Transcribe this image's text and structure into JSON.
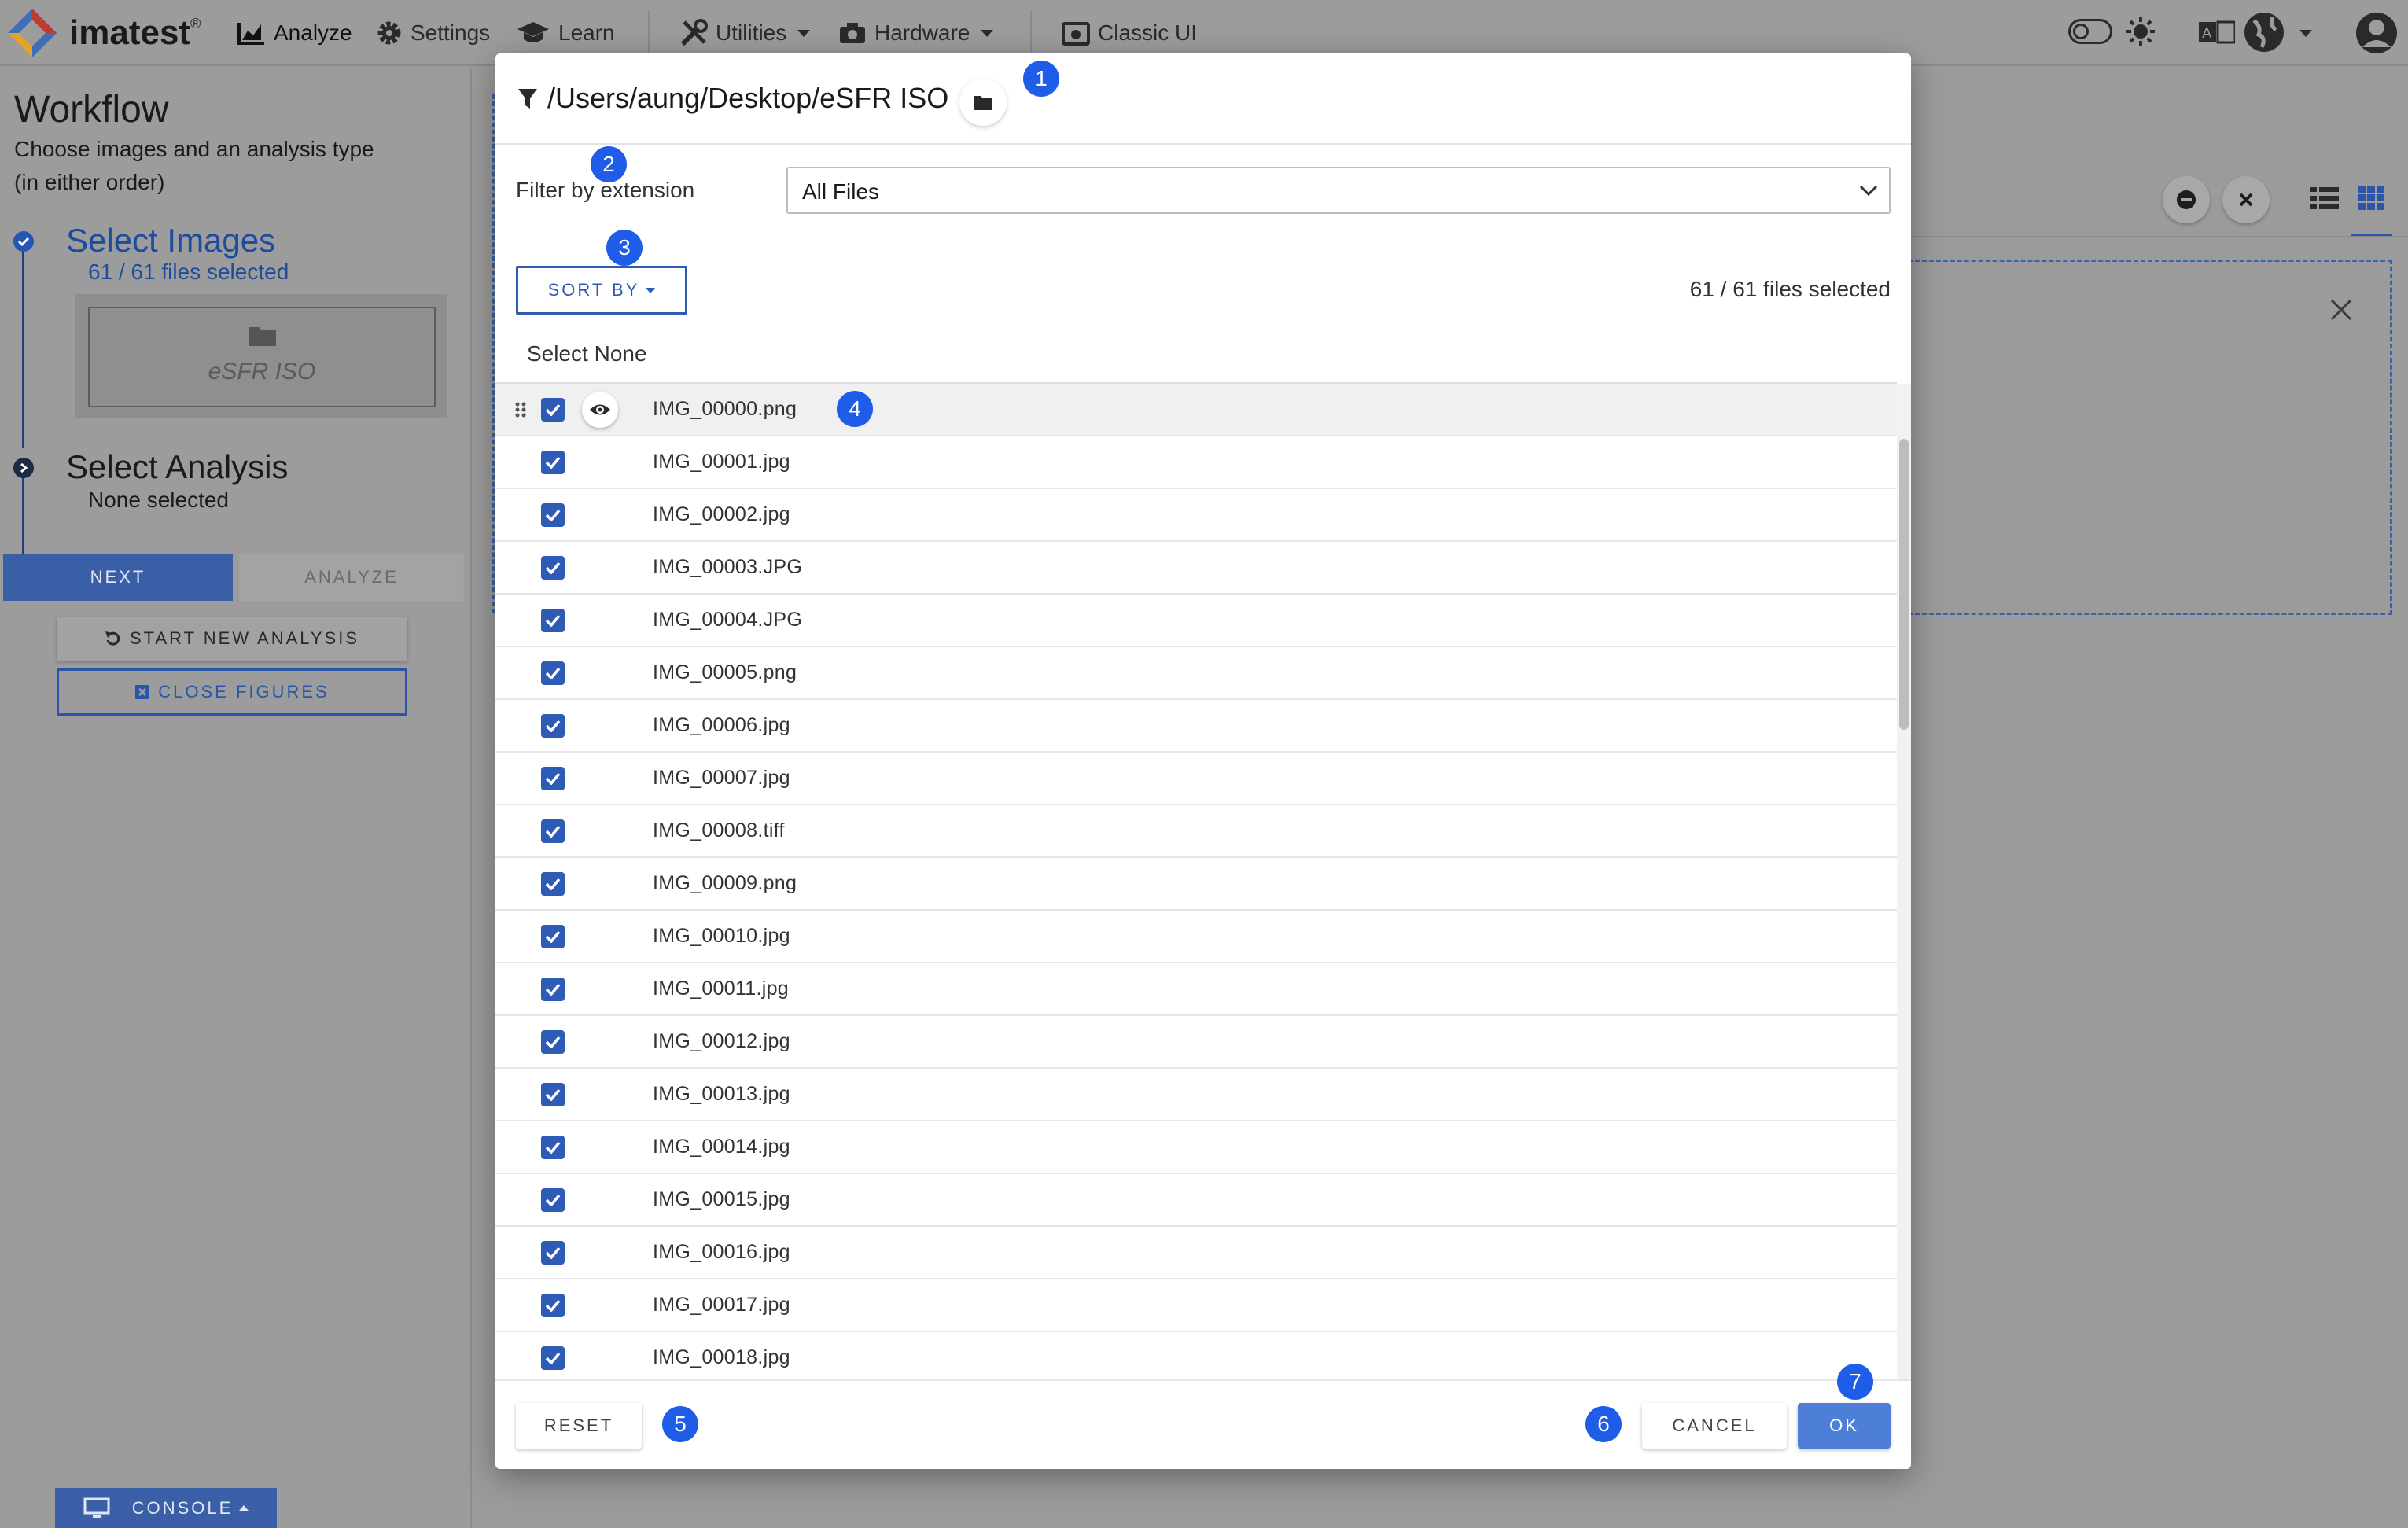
{
  "nav": {
    "brand": "imatest",
    "brand_mark": "®",
    "analyze": "Analyze",
    "settings": "Settings",
    "learn": "Learn",
    "utilities": "Utilities",
    "hardware": "Hardware",
    "classic_ui": "Classic UI"
  },
  "workflow": {
    "title": "Workflow",
    "subtitle_line1": "Choose images and an analysis type",
    "subtitle_line2": "(in either order)",
    "step1_title": "Select Images",
    "step1_status": "61 / 61 files selected",
    "folder_name": "eSFR ISO",
    "step2_title": "Select Analysis",
    "step2_status": "None selected",
    "next_label": "NEXT",
    "analyze_label": "ANALYZE",
    "start_new_label": "START NEW ANALYSIS",
    "close_figures_label": "CLOSE FIGURES",
    "console_label": "CONSOLE"
  },
  "dialog": {
    "path": "/Users/aung/Desktop/eSFR ISO",
    "filter_label": "Filter by extension",
    "filter_value": "All Files",
    "sort_by_label": "SORT BY",
    "selection_count": "61 / 61 files selected",
    "select_none_label": "Select None",
    "files": [
      "IMG_00000.png",
      "IMG_00001.jpg",
      "IMG_00002.jpg",
      "IMG_00003.JPG",
      "IMG_00004.JPG",
      "IMG_00005.png",
      "IMG_00006.jpg",
      "IMG_00007.jpg",
      "IMG_00008.tiff",
      "IMG_00009.png",
      "IMG_00010.jpg",
      "IMG_00011.jpg",
      "IMG_00012.jpg",
      "IMG_00013.jpg",
      "IMG_00014.jpg",
      "IMG_00015.jpg",
      "IMG_00016.jpg",
      "IMG_00017.jpg",
      "IMG_00018.jpg"
    ],
    "reset_label": "RESET",
    "cancel_label": "CANCEL",
    "ok_label": "OK"
  },
  "badges": [
    "1",
    "2",
    "3",
    "4",
    "5",
    "6",
    "7"
  ],
  "colors": {
    "accent": "#2e5bb5",
    "badge": "#1f5ce8",
    "overlay": "#9c9c9c"
  }
}
